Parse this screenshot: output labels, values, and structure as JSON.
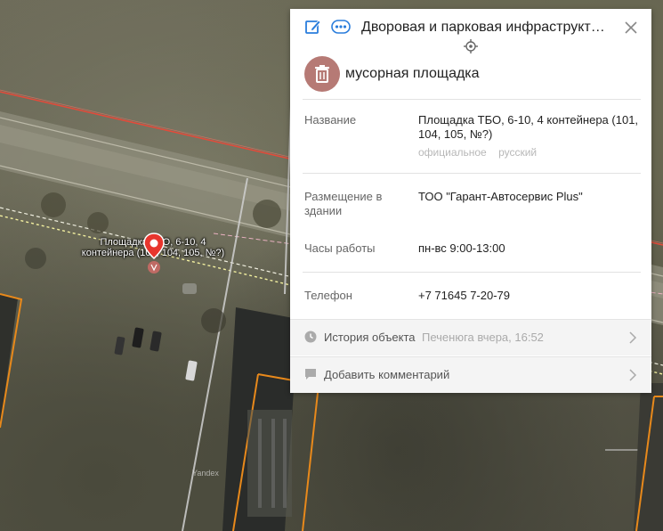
{
  "map": {
    "object_label": "Площадка ТБО, 6-10, 4 контейнера (101, 104, 105, №?)",
    "watermark": "Yandex"
  },
  "panel": {
    "title": "Дворовая и парковая инфраструкт…",
    "category": "мусорная площадка",
    "fields": {
      "name_label": "Название",
      "name_value": "Площадка ТБО, 6-10, 4 контейнера (101, 104, 105, №?)",
      "lang_official": "официальное",
      "lang_russian": "русский",
      "placement_label": "Размещение в здании",
      "placement_value": "ТОО \"Гарант-Автосервис Plus\"",
      "hours_label": "Часы работы",
      "hours_value": "пн-вс 9:00-13:00",
      "phone_label": "Телефон",
      "phone_value": "+7 71645 7-20-79"
    },
    "history": {
      "label": "История объекта",
      "meta": "Печенюга вчера, 16:52"
    },
    "comment": {
      "label": "Добавить комментарий"
    }
  },
  "colors": {
    "category_icon_bg": "#b67a75",
    "edit_icon": "#2a7ddc",
    "parcel_border": "#e8891b",
    "road_line": "#e54a3a"
  },
  "icons": [
    "edit-icon",
    "more-icon",
    "close-icon",
    "locate-icon",
    "trash-icon",
    "history-icon",
    "comment-icon",
    "chevron-right-icon",
    "map-pin-icon"
  ]
}
